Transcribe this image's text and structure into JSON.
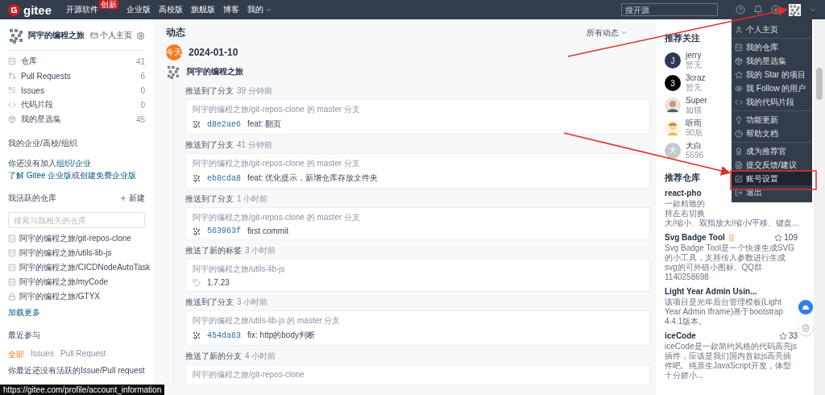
{
  "nav": {
    "logo": "gitee",
    "links": [
      {
        "label": "开源软件",
        "badge": "创新",
        "dropdown": false
      },
      {
        "label": "企业版",
        "dropdown": false
      },
      {
        "label": "高校版",
        "dropdown": false
      },
      {
        "label": "旗舰版",
        "dropdown": false
      },
      {
        "label": "博客",
        "dropdown": false
      },
      {
        "label": "我的",
        "dropdown": true
      }
    ],
    "search_placeholder": "搜开源"
  },
  "sidebar": {
    "user": "阿宇的编程之旅",
    "home_link": "个人主页",
    "stats": [
      {
        "label": "仓库",
        "count": "41"
      },
      {
        "label": "Pull Requests",
        "count": "6"
      },
      {
        "label": "Issues",
        "count": "0"
      },
      {
        "label": "代码片段",
        "count": "0"
      },
      {
        "label": "我的星选集",
        "count": "45"
      }
    ],
    "org_title": "我的企业/高校/组织",
    "org_lines": [
      [
        {
          "text": "你还没有加入",
          "link": false
        },
        {
          "text": "组织/",
          "link": true
        },
        {
          "text": "企业",
          "link": true
        }
      ],
      [
        {
          "text": "了解 Gitee 企业版",
          "link": true
        },
        {
          "text": "或",
          "link": false
        },
        {
          "text": "创建免费企业版",
          "link": true
        }
      ]
    ],
    "repos_title": "我活跃的仓库",
    "new_label": "新建",
    "repo_search_placeholder": "搜索与我相关的仓库",
    "repos": [
      {
        "name": "阿宇的编程之旅/git-repos-clone",
        "private": false
      },
      {
        "name": "阿宇的编程之旅/utils-lib-js",
        "private": false
      },
      {
        "name": "阿宇的编程之旅/CICDNodeAutoTask",
        "private": false
      },
      {
        "name": "阿宇的编程之旅/myCode",
        "private": false
      },
      {
        "name": "阿宇的编程之旅/GTYX",
        "private": true
      }
    ],
    "load_more": "加载更多",
    "recent_title": "最近参与",
    "recent_tabs": [
      {
        "label": "全部",
        "selected": true
      },
      {
        "label": "Issues",
        "selected": false
      },
      {
        "label": "Pull Request",
        "selected": false
      }
    ],
    "recent_empty": "你最近还没有活跃的Issue/Pull request"
  },
  "feed": {
    "title": "动态",
    "filter": "所有动态",
    "day_badge": "今天",
    "date": "2024-01-10",
    "user": "阿宇的编程之旅",
    "events": [
      {
        "kind": "commit",
        "action": "推送到了分支",
        "time": "39 分钟前",
        "repo": "阿宇的编程之旅/git-repos-clone 的 master 分支",
        "hash": "d8e2ae6",
        "message": "feat: 翻页"
      },
      {
        "kind": "commit",
        "action": "推送到了分支",
        "time": "41 分钟前",
        "repo": "阿宇的编程之旅/git-repos-clone 的 master 分支",
        "hash": "eb8cda8",
        "message": "feat: 优化提示，新增仓库存放文件夹"
      },
      {
        "kind": "commit",
        "action": "推送到了分支",
        "time": "1 小时前",
        "repo": "阿宇的编程之旅/git-repos-clone 的 master 分支",
        "hash": "563963f",
        "message": "first commit"
      },
      {
        "kind": "tag",
        "action": "推送了新的标签",
        "time": "3 小时前",
        "repo": "阿宇的编程之旅/utils-lib-js",
        "tag": "1.7.23"
      },
      {
        "kind": "commit",
        "action": "推送到了分支",
        "time": "3 小时前",
        "repo": "阿宇的编程之旅/utils-lib-js 的 master 分支",
        "hash": "454da63",
        "message": "fix: http的body判断"
      },
      {
        "kind": "branch",
        "action": "推送了新的分支",
        "time": "4 小时前",
        "repo": "阿宇的编程之旅/git-repos-clone"
      }
    ]
  },
  "recommend": {
    "follow_title": "推荐关注",
    "users": [
      {
        "kind": "letter",
        "initial": "J",
        "color": "#2d3a55",
        "name": "jerry",
        "bio": "暂无"
      },
      {
        "kind": "letter",
        "initial": "3",
        "color": "#000000",
        "name": "3craz",
        "bio": "暂无"
      },
      {
        "kind": "photo",
        "name": "Super",
        "bio": "如猫"
      },
      {
        "kind": "cartoon",
        "name": "听雨",
        "bio": "90后"
      },
      {
        "kind": "letter",
        "initial": "大",
        "color": "#c4c8cf",
        "name": "大白",
        "bio": "5596"
      }
    ],
    "repos_title": "推荐仓库",
    "repos": [
      {
        "name": "react-pho",
        "lines": [
          "一款精致的",
          "持左右切换",
          "大/缩小、双指放大/缩小/平移、键盘..."
        ],
        "badge": false
      },
      {
        "name": "Svg Badge Tool",
        "lines": [
          "Svg Badge Tool是一个快速生成SVG的小工具，支持传入参数进行生成svg的可外链小图标。QQ群1140258698"
        ],
        "stars_text": "109",
        "badge": true
      },
      {
        "name": "Light Year Admin Usin...",
        "lines": [
          "该项目是光年后台管理模板(Light Year Admin Iframe)基于bootstrap 4.4.1版本。"
        ],
        "badge": false
      },
      {
        "name": "iceCode",
        "lines": [
          "iceCode是一款简约风格的代码高亮js插件，应该是我们国内首款js高亮插件吧。纯原生JavaScript开发，体型十分娇小..."
        ],
        "stars_text": "33",
        "badge": false
      }
    ]
  },
  "menu": {
    "groups": [
      {
        "items": [
          {
            "label": "个人主页",
            "selected": false
          }
        ]
      },
      {
        "items": [
          {
            "label": "我的仓库",
            "selected": false
          },
          {
            "label": "我的星选集",
            "selected": false
          },
          {
            "label": "我的 Star 的项目",
            "selected": false
          },
          {
            "label": "我 Follow 的用户",
            "selected": false
          },
          {
            "label": "我的代码片段",
            "selected": false
          }
        ]
      },
      {
        "items": [
          {
            "label": "功能更新",
            "selected": false
          },
          {
            "label": "帮助文档",
            "selected": false
          }
        ]
      },
      {
        "items": [
          {
            "label": "成为推荐官",
            "selected": false
          },
          {
            "label": "提交反馈/建议",
            "selected": false
          },
          {
            "label": "账号设置",
            "selected": true
          },
          {
            "label": "退出",
            "selected": false
          }
        ]
      }
    ]
  },
  "status_url": "https://gitee.com/profile/account_information"
}
